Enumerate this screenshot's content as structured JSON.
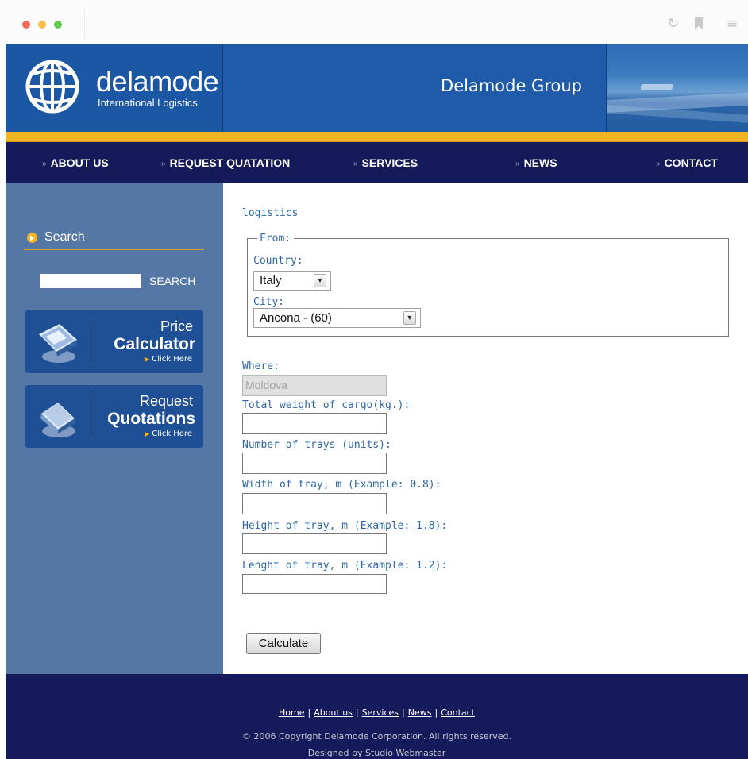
{
  "browser": {
    "reload_icon": "reload-icon",
    "bookmark_icon": "bookmark-icon",
    "menu_icon": "menu-icon"
  },
  "header": {
    "logo_name": "delamode",
    "logo_subtitle": "International Logistics",
    "site_title": "Delamode Group"
  },
  "nav": {
    "items": [
      {
        "label": "ABOUT US"
      },
      {
        "label": "REQUEST QUATATION"
      },
      {
        "label": "SERVICES"
      },
      {
        "label": "NEWS"
      },
      {
        "label": "CONTACT"
      }
    ]
  },
  "sidebar": {
    "search_title": "Search",
    "search_placeholder": "",
    "search_button": "SEARCH",
    "price_calculator": {
      "line1": "Price",
      "line2": "Calculator",
      "cta": "Click Here"
    },
    "request_quotations": {
      "line1": "Request",
      "line2": "Quotations",
      "cta": "Click Here"
    }
  },
  "form": {
    "link": "logistics",
    "from_legend": "From:",
    "country_label": "Country:",
    "country_value": "Italy",
    "city_label": "City:",
    "city_value": "Ancona - (60)",
    "where_label": "Where:",
    "where_value": "Moldova",
    "weight_label": "Total weight of cargo(kg.):",
    "trays_label": "Number of trays (units):",
    "width_label": "Width of tray, m (Example: 0.8):",
    "height_label": "Height of tray, m (Example: 1.8):",
    "length_label": "Lenght of tray, m (Example: 1.2):",
    "calculate_button": "Calculate",
    "weight_value": "",
    "trays_value": "",
    "width_value": "",
    "height_value": "",
    "length_value": ""
  },
  "footer": {
    "links": [
      {
        "label": "Home"
      },
      {
        "label": "About us"
      },
      {
        "label": "Services"
      },
      {
        "label": "News"
      },
      {
        "label": "Contact"
      }
    ],
    "separator": "|",
    "copyright": "© 2006 Copyright Delamode Corporation. All rights reserved.",
    "designed_by": "Designed by Studio Webmaster"
  },
  "colors": {
    "header_blue": "#1f5ba8",
    "nav_navy": "#151a5a",
    "gold_accent": "#f0b422",
    "sidebar_blue": "#5577a6",
    "form_text_blue": "#2f66a5"
  }
}
